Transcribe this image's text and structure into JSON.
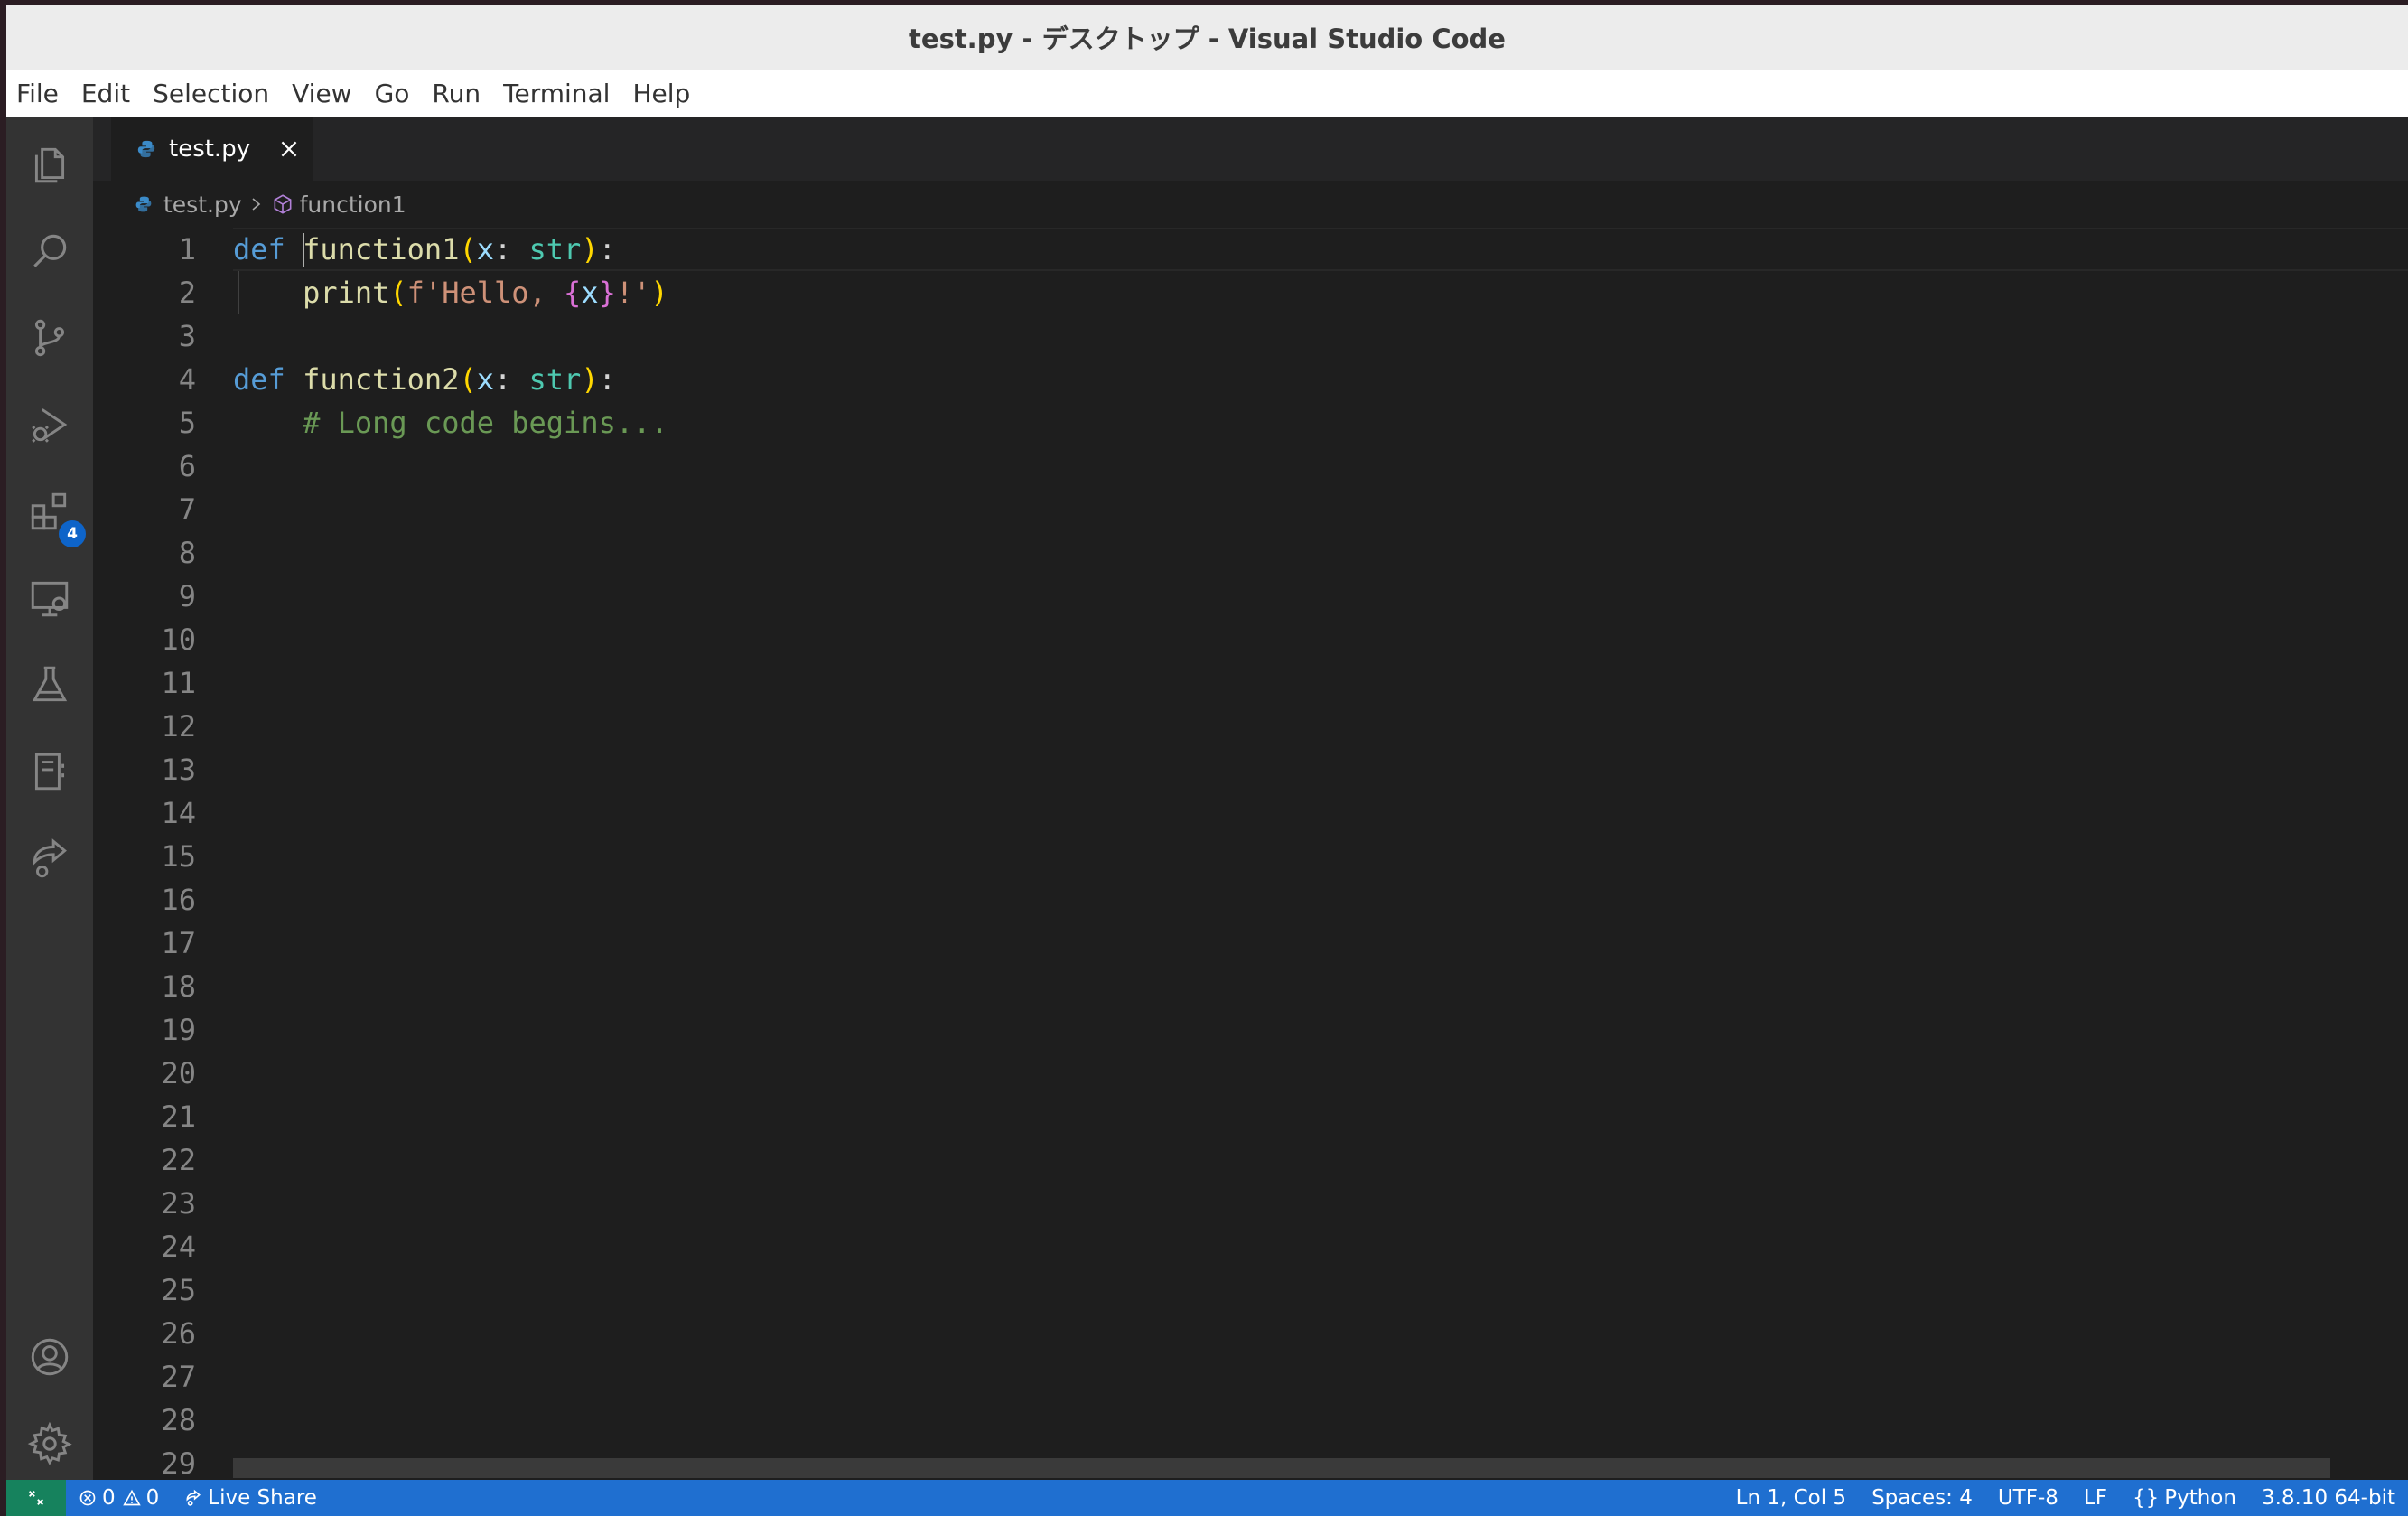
{
  "window": {
    "title": "test.py - デスクトップ - Visual Studio Code"
  },
  "menu": [
    "File",
    "Edit",
    "Selection",
    "View",
    "Go",
    "Run",
    "Terminal",
    "Help"
  ],
  "activity_bar": {
    "items": [
      "explorer-icon",
      "search-icon",
      "source-control-icon",
      "run-debug-icon",
      "extensions-icon",
      "remote-explorer-icon",
      "testing-icon",
      "notebook-icon",
      "live-share-icon"
    ],
    "extensions_badge": "4",
    "bottom_items": [
      "accounts-icon",
      "settings-gear-icon"
    ]
  },
  "tab": {
    "label": "test.py"
  },
  "breadcrumb": {
    "file": "test.py",
    "symbol": "function1"
  },
  "editor": {
    "line_numbers": [
      "1",
      "2",
      "3",
      "4",
      "5",
      "6",
      "7",
      "8",
      "9",
      "10",
      "11",
      "12",
      "13",
      "14",
      "15",
      "16",
      "17",
      "18",
      "19",
      "20",
      "21",
      "22",
      "23",
      "24",
      "25",
      "26",
      "27",
      "28",
      "29"
    ],
    "code": [
      [
        {
          "t": "def",
          "c": "kw"
        },
        {
          "t": " "
        },
        {
          "t": "function1",
          "c": "fn"
        },
        {
          "t": "(",
          "c": "br1"
        },
        {
          "t": "x",
          "c": "pr"
        },
        {
          "t": ": "
        },
        {
          "t": "str",
          "c": "ty"
        },
        {
          "t": ")",
          "c": "br1"
        },
        {
          "t": ":"
        }
      ],
      [
        {
          "t": "    "
        },
        {
          "t": "print",
          "c": "fn"
        },
        {
          "t": "(",
          "c": "br1"
        },
        {
          "t": "f'Hello, ",
          "c": "st"
        },
        {
          "t": "{",
          "c": "br2"
        },
        {
          "t": "x",
          "c": "pr"
        },
        {
          "t": "}",
          "c": "br2"
        },
        {
          "t": "!'",
          "c": "st"
        },
        {
          "t": ")",
          "c": "br1"
        }
      ],
      [],
      [
        {
          "t": "def",
          "c": "kw"
        },
        {
          "t": " "
        },
        {
          "t": "function2",
          "c": "fn"
        },
        {
          "t": "(",
          "c": "br1"
        },
        {
          "t": "x",
          "c": "pr"
        },
        {
          "t": ": "
        },
        {
          "t": "str",
          "c": "ty"
        },
        {
          "t": ")",
          "c": "br1"
        },
        {
          "t": ":"
        }
      ],
      [
        {
          "t": "    "
        },
        {
          "t": "# Long code begins...",
          "c": "cm"
        }
      ]
    ]
  },
  "status_bar": {
    "errors": "0",
    "warnings": "0",
    "live_share": "Live Share",
    "position": "Ln 1, Col 5",
    "spaces": "Spaces: 4",
    "encoding": "UTF-8",
    "eol": "LF",
    "language": "Python",
    "interpreter": "3.8.10 64-bit"
  },
  "colors": {
    "status_bar": "#1f6fd0",
    "remote_indicator": "#16825d",
    "badge": "#0e64c9"
  }
}
